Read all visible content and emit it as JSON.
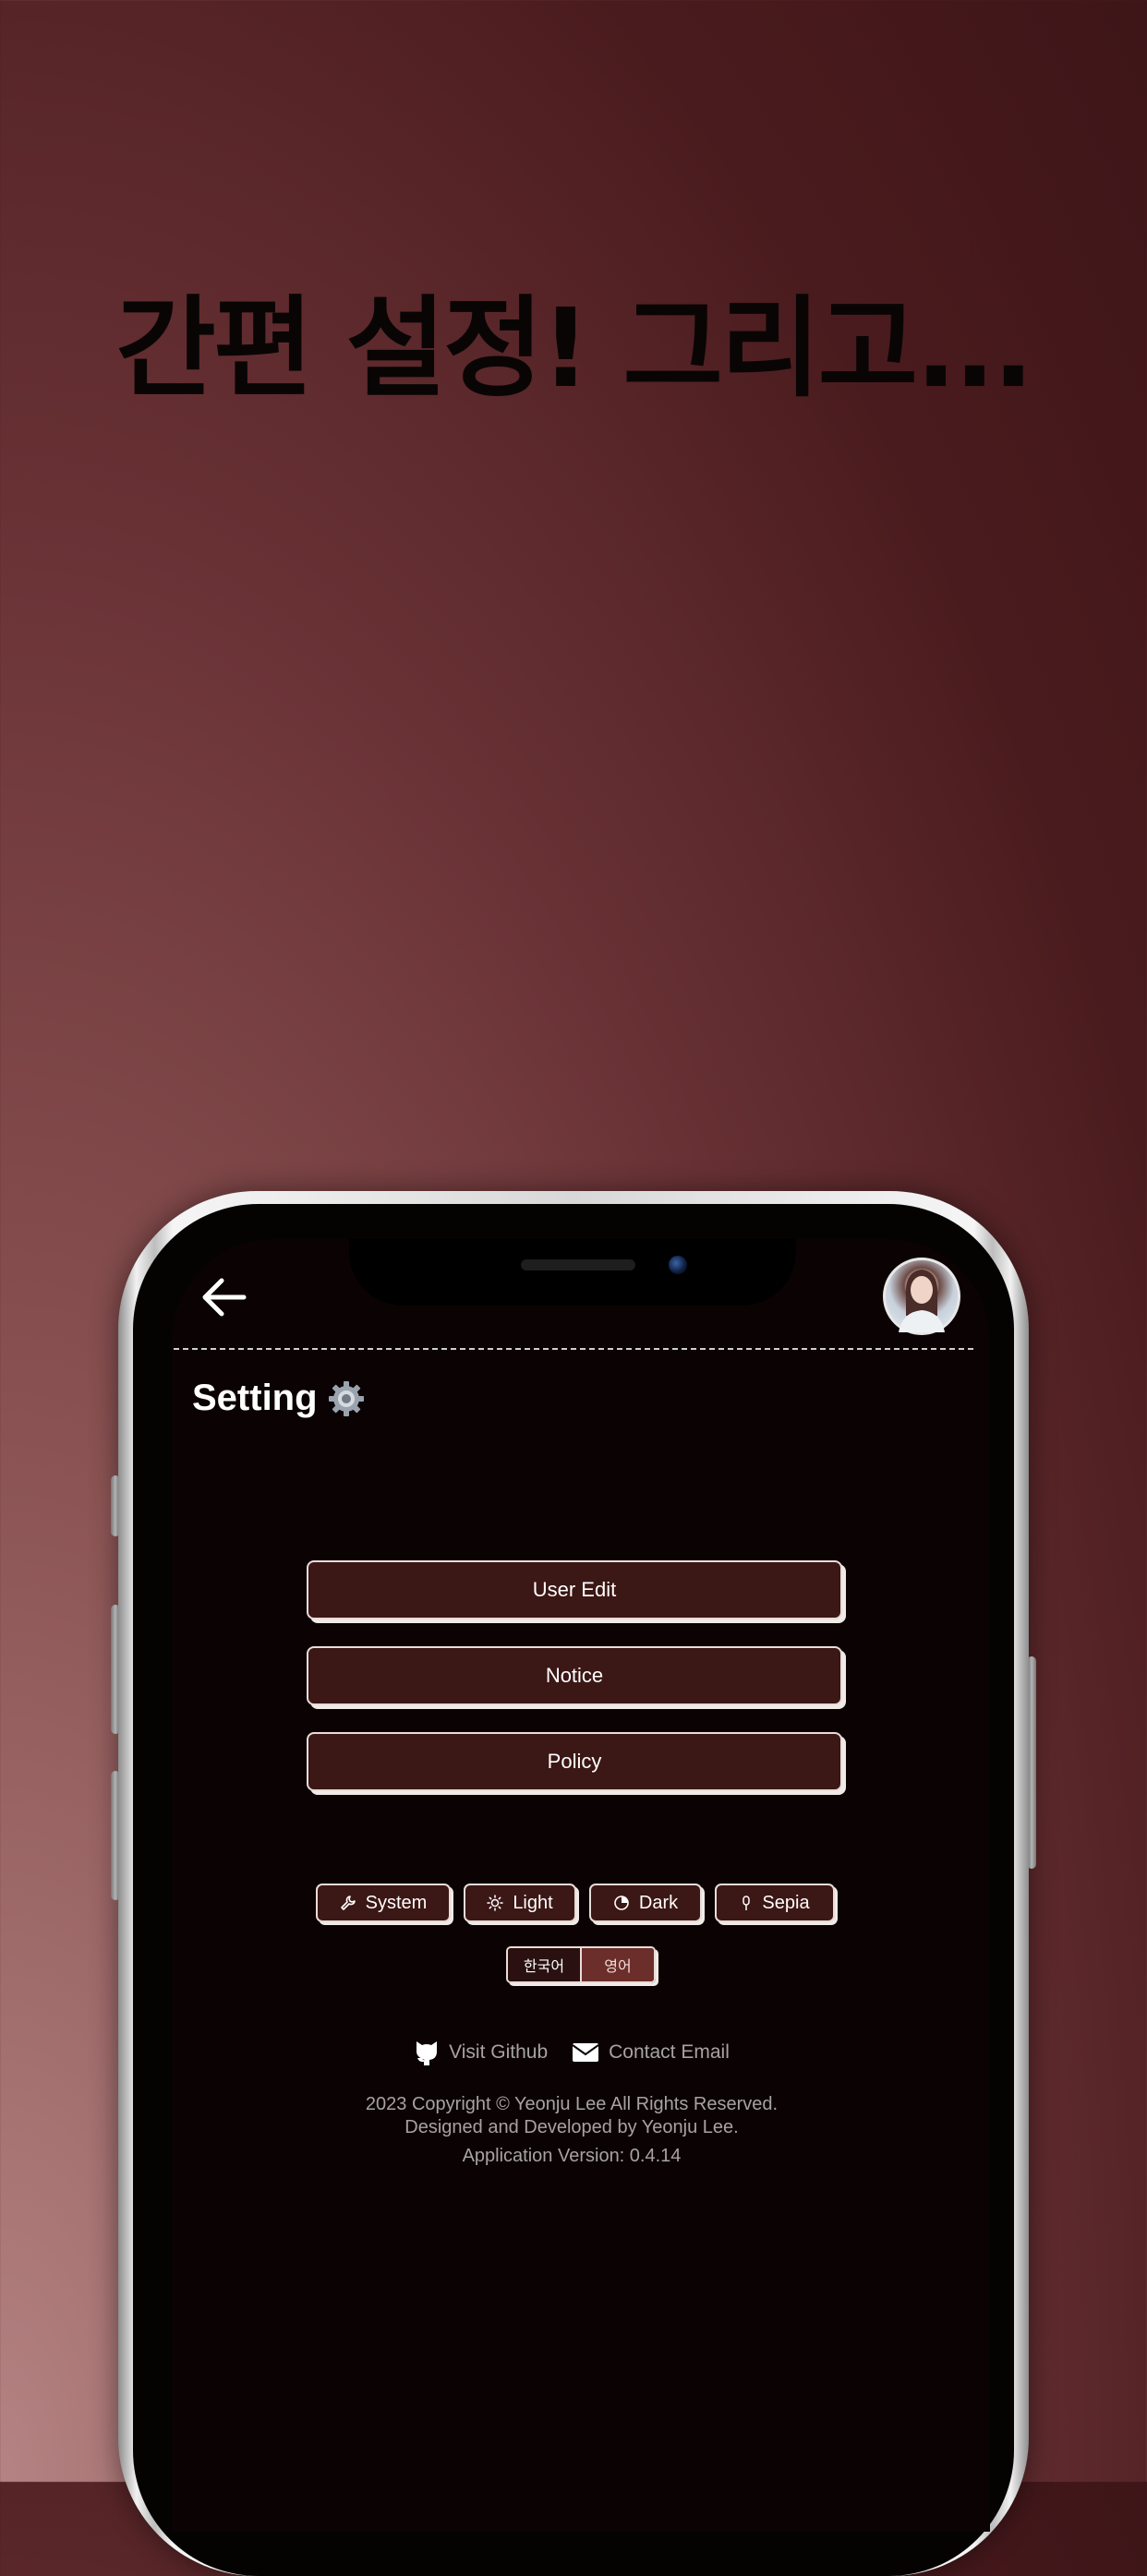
{
  "headline": "간편 설정! 그리고...",
  "header": {
    "back_icon": "arrow-left-icon",
    "avatar_icon": "profile-avatar"
  },
  "page": {
    "title": "Setting",
    "title_icon": "gear-icon"
  },
  "menu": [
    {
      "label": "User Edit"
    },
    {
      "label": "Notice"
    },
    {
      "label": "Policy"
    }
  ],
  "themes": [
    {
      "label": "System",
      "icon": "wrench-icon"
    },
    {
      "label": "Light",
      "icon": "sun-icon"
    },
    {
      "label": "Dark",
      "icon": "moon-icon"
    },
    {
      "label": "Sepia",
      "icon": "pin-icon"
    }
  ],
  "languages": [
    {
      "label": "한국어",
      "active": false
    },
    {
      "label": "영어",
      "active": true
    }
  ],
  "links": {
    "github": "Visit Github",
    "email": "Contact Email"
  },
  "footer": {
    "copyright": "2023 Copyright © Yeonju Lee All Rights Reserved.",
    "designed": "Designed and Developed by Yeonju Lee.",
    "version": "Application Version: 0.4.14"
  },
  "colors": {
    "button_bg": "#3b1715",
    "screen_bg": "#0b0303",
    "accent_active": "#6b2e2a"
  }
}
